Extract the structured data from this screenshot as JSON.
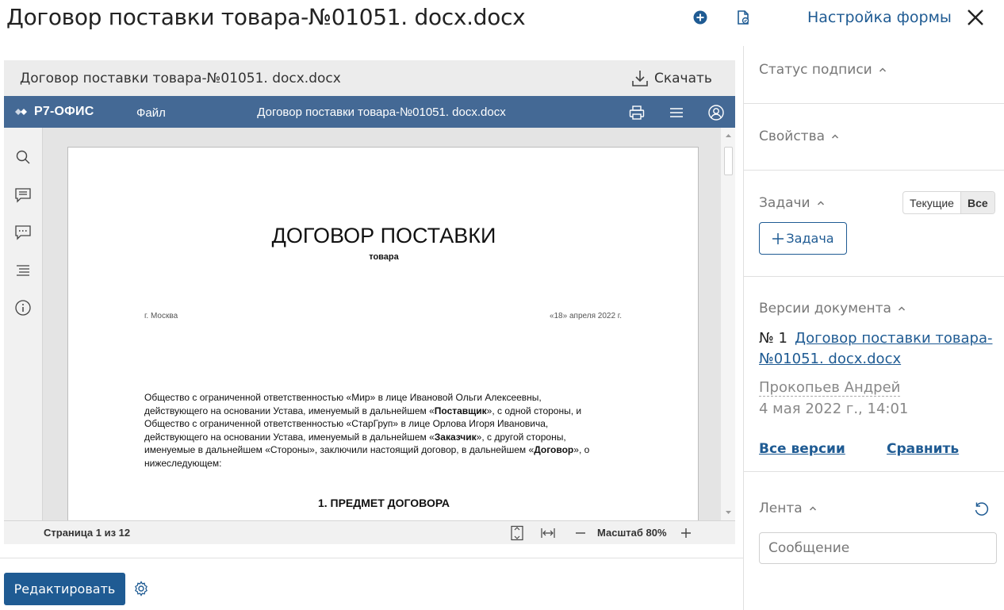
{
  "header": {
    "title": "Договор поставки товара-№01051. docx.docx",
    "settings_label": "Настройка формы",
    "icons": [
      "add-circle-icon",
      "document-sign-icon",
      "close-icon"
    ]
  },
  "document": {
    "head_title": "Договор поставки товара-№01051. docx.docx",
    "download_label": "Скачать"
  },
  "editor": {
    "logo": "Р7-ОФИС",
    "file_menu": "Файл",
    "title": "Договор поставки товара-№01051. docx.docx",
    "page": {
      "heading": "ДОГОВОР ПОСТАВКИ",
      "subheading": "товара",
      "city": "г. Москва",
      "date": "«18» апреля 2022 г.",
      "body_1": "Общество с ограниченной ответственностью «Мир» в лице Ивановой Ольги Алексеевны, действующего на основании Устава, именуемый в дальнейшем «",
      "body_bold_1": "Поставщик",
      "body_2": "», с одной стороны, и Общество с ограниченной ответственностью «СтарГруп» в лице Орлова Игоря Ивановича, действующего на основании Устава, именуемый в дальнейшем «",
      "body_bold_2": "Заказчик",
      "body_3": "», с другой стороны, именуемые в дальнейшем «Стороны», заключили настоящий договор, в дальнейшем «",
      "body_bold_3": "Договор",
      "body_4": "», о нижеследующем:",
      "section_1": "1. ПРЕДМЕТ ДОГОВОРА"
    },
    "status": {
      "page_counter": "Страница 1 из 12",
      "zoom": "Масштаб 80%"
    }
  },
  "actions": {
    "edit_label": "Редактировать"
  },
  "right_panel": {
    "signature_status": "Статус подписи",
    "properties": "Свойства",
    "tasks": {
      "heading": "Задачи",
      "filter_current": "Текущие",
      "filter_all": "Все",
      "add_task": "Задача"
    },
    "versions": {
      "heading": "Версии документа",
      "number": "№ 1",
      "file_link": "Договор поставки товара-№01051. docx.docx",
      "author": "Прокопьев Андрей",
      "date": "4 мая 2022 г., 14:01",
      "all_versions": "Все версии",
      "compare": "Сравнить"
    },
    "feed": {
      "heading": "Лента",
      "message_placeholder": "Сообщение"
    }
  },
  "colors": {
    "accent": "#1f5b93",
    "editor_bar": "#446995"
  }
}
